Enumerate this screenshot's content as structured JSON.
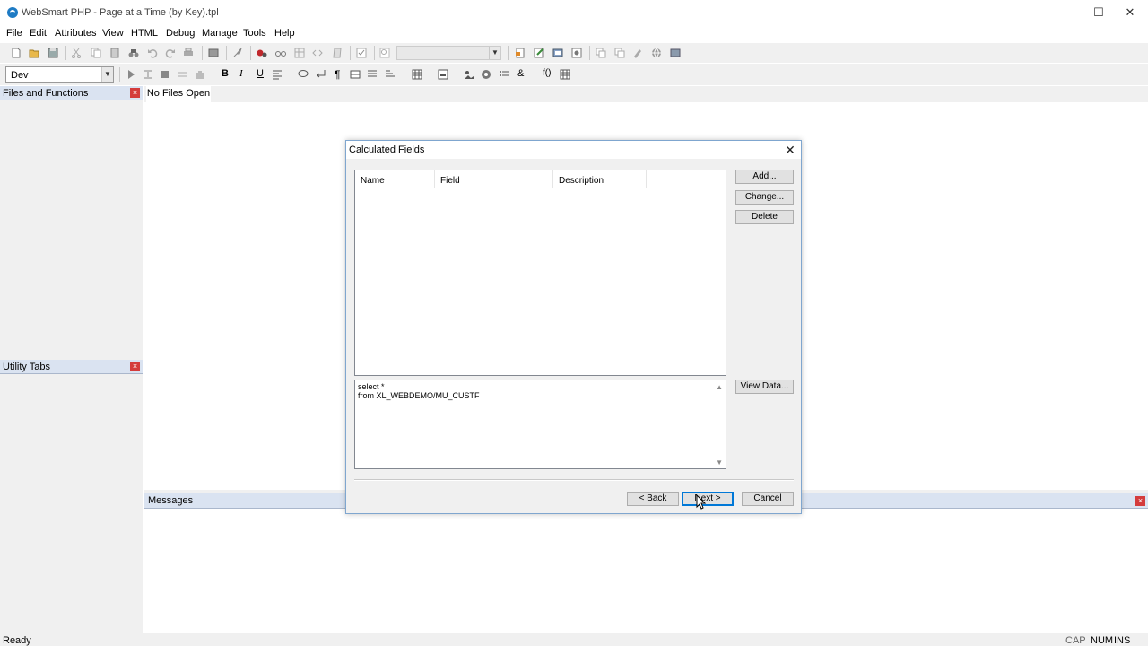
{
  "window": {
    "title": "WebSmart PHP - Page at a Time (by Key).tpl",
    "controls": {
      "minimize": "—",
      "maximize": "☐",
      "close": "✕"
    }
  },
  "menu": [
    "File",
    "Edit",
    "Attributes",
    "View",
    "HTML",
    "Debug",
    "Manage",
    "Tools",
    "Help"
  ],
  "toolbar": {
    "config_combo_value": "Dev",
    "search_combo_value": ""
  },
  "panels": {
    "files_and_functions": "Files and Functions",
    "utility_tabs": "Utility Tabs",
    "messages": "Messages"
  },
  "editor": {
    "tab_label": "No Files Open"
  },
  "dialog": {
    "title": "Calculated Fields",
    "columns": [
      "Name",
      "Field",
      "Description"
    ],
    "rows": [],
    "sql_lines": [
      "select *",
      "from XL_WEBDEMO/MU_CUSTF"
    ],
    "buttons": {
      "add": "Add...",
      "change": "Change...",
      "delete": "Delete",
      "view_data": "View Data...",
      "back": "< Back",
      "next": "Next >",
      "cancel": "Cancel"
    }
  },
  "status": {
    "left": "Ready",
    "cap": "CAP",
    "num": "NUM",
    "ins": "INS"
  },
  "colors": {
    "panel_header": "#dae3f1",
    "panel_close": "#d43c3c",
    "dialog_border": "#7fa6cf",
    "default_button_border": "#0078d7"
  }
}
